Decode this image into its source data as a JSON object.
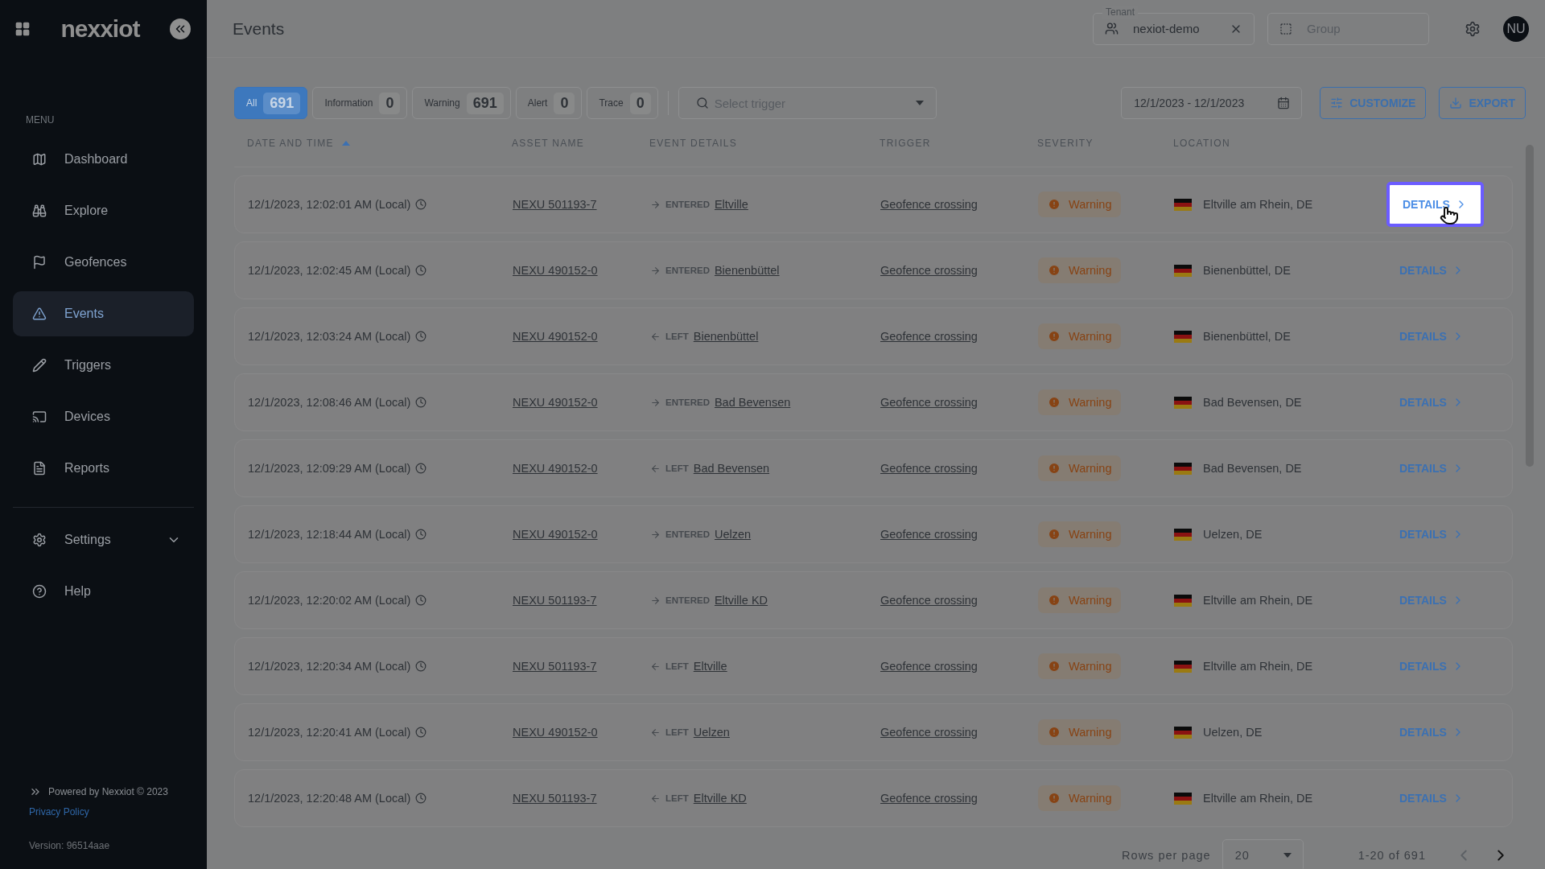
{
  "sidebar": {
    "logo": "nexxiot",
    "menu_label": "MENU",
    "items": [
      {
        "label": "Dashboard",
        "selected": false
      },
      {
        "label": "Explore",
        "selected": false
      },
      {
        "label": "Geofences",
        "selected": false
      },
      {
        "label": "Events",
        "selected": true
      },
      {
        "label": "Triggers",
        "selected": false
      },
      {
        "label": "Devices",
        "selected": false
      },
      {
        "label": "Reports",
        "selected": false
      }
    ],
    "settings": {
      "label": "Settings",
      "expanded": false
    },
    "help": "Help",
    "footer": {
      "powered": "Powered by Nexxiot © 2023",
      "privacy": "Privacy Policy",
      "version": "Version: 96514aae"
    }
  },
  "header": {
    "title": "Events",
    "tenant": {
      "label": "Tenant",
      "value": "nexiot-demo"
    },
    "group": {
      "placeholder": "Group"
    },
    "avatar": "NU"
  },
  "filters": [
    {
      "label": "All",
      "count": "691",
      "selected": true
    },
    {
      "label": "Information",
      "count": "0",
      "selected": false
    },
    {
      "label": "Warning",
      "count": "691",
      "selected": false
    },
    {
      "label": "Alert",
      "count": "0",
      "selected": false
    },
    {
      "label": "Trace",
      "count": "0",
      "selected": false
    }
  ],
  "trigger_select": {
    "placeholder": "Select trigger"
  },
  "date_range": "12/1/2023 - 12/1/2023",
  "actions": [
    "CUSTOMIZE",
    "EXPORT"
  ],
  "table": {
    "columns": [
      {
        "label": "DATE AND TIME",
        "sorted": true
      },
      {
        "label": "ASSET NAME",
        "sorted": false
      },
      {
        "label": "EVENT DETAILS",
        "sorted": false
      },
      {
        "label": "TRIGGER",
        "sorted": false
      },
      {
        "label": "SEVERITY",
        "sorted": false
      },
      {
        "label": "LOCATION",
        "sorted": false
      }
    ],
    "rows": [
      {
        "date": "12/1/2023, 12:02:01 AM (Local)",
        "asset": "NEXU 501193-7",
        "kind": "entered",
        "direction": "ENTERED",
        "place": "Eltville",
        "trigger": "Geofence crossing",
        "severity": "Warning",
        "location": "Eltville am Rhein, DE",
        "details": "DETAILS",
        "focused": true
      },
      {
        "date": "12/1/2023, 12:02:45 AM (Local)",
        "asset": "NEXU 490152-0",
        "kind": "entered",
        "direction": "ENTERED",
        "place": "Bienenbüttel",
        "trigger": "Geofence crossing",
        "severity": "Warning",
        "location": "Bienenbüttel, DE",
        "details": "DETAILS",
        "focused": false
      },
      {
        "date": "12/1/2023, 12:03:24 AM (Local)",
        "asset": "NEXU 490152-0",
        "kind": "left",
        "direction": "LEFT",
        "place": "Bienenbüttel",
        "trigger": "Geofence crossing",
        "severity": "Warning",
        "location": "Bienenbüttel, DE",
        "details": "DETAILS",
        "focused": false
      },
      {
        "date": "12/1/2023, 12:08:46 AM (Local)",
        "asset": "NEXU 490152-0",
        "kind": "entered",
        "direction": "ENTERED",
        "place": "Bad Bevensen",
        "trigger": "Geofence crossing",
        "severity": "Warning",
        "location": "Bad Bevensen, DE",
        "details": "DETAILS",
        "focused": false
      },
      {
        "date": "12/1/2023, 12:09:29 AM (Local)",
        "asset": "NEXU 490152-0",
        "kind": "left",
        "direction": "LEFT",
        "place": "Bad Bevensen",
        "trigger": "Geofence crossing",
        "severity": "Warning",
        "location": "Bad Bevensen, DE",
        "details": "DETAILS",
        "focused": false
      },
      {
        "date": "12/1/2023, 12:18:44 AM (Local)",
        "asset": "NEXU 490152-0",
        "kind": "entered",
        "direction": "ENTERED",
        "place": "Uelzen",
        "trigger": "Geofence crossing",
        "severity": "Warning",
        "location": "Uelzen, DE",
        "details": "DETAILS",
        "focused": false
      },
      {
        "date": "12/1/2023, 12:20:02 AM (Local)",
        "asset": "NEXU 501193-7",
        "kind": "entered",
        "direction": "ENTERED",
        "place": "Eltville KD",
        "trigger": "Geofence crossing",
        "severity": "Warning",
        "location": "Eltville am Rhein, DE",
        "details": "DETAILS",
        "focused": false
      },
      {
        "date": "12/1/2023, 12:20:34 AM (Local)",
        "asset": "NEXU 501193-7",
        "kind": "left",
        "direction": "LEFT",
        "place": "Eltville",
        "trigger": "Geofence crossing",
        "severity": "Warning",
        "location": "Eltville am Rhein, DE",
        "details": "DETAILS",
        "focused": false
      },
      {
        "date": "12/1/2023, 12:20:41 AM (Local)",
        "asset": "NEXU 490152-0",
        "kind": "left",
        "direction": "LEFT",
        "place": "Uelzen",
        "trigger": "Geofence crossing",
        "severity": "Warning",
        "location": "Uelzen, DE",
        "details": "DETAILS",
        "focused": false
      },
      {
        "date": "12/1/2023, 12:20:48 AM (Local)",
        "asset": "NEXU 501193-7",
        "kind": "left",
        "direction": "LEFT",
        "place": "Eltville KD",
        "trigger": "Geofence crossing",
        "severity": "Warning",
        "location": "Eltville am Rhein, DE",
        "details": "DETAILS",
        "focused": false
      }
    ]
  },
  "pagination": {
    "label": "Rows per page",
    "rows_per_page": "20",
    "range": "1-20 of 691",
    "prev_disabled": true,
    "next_disabled": false
  }
}
